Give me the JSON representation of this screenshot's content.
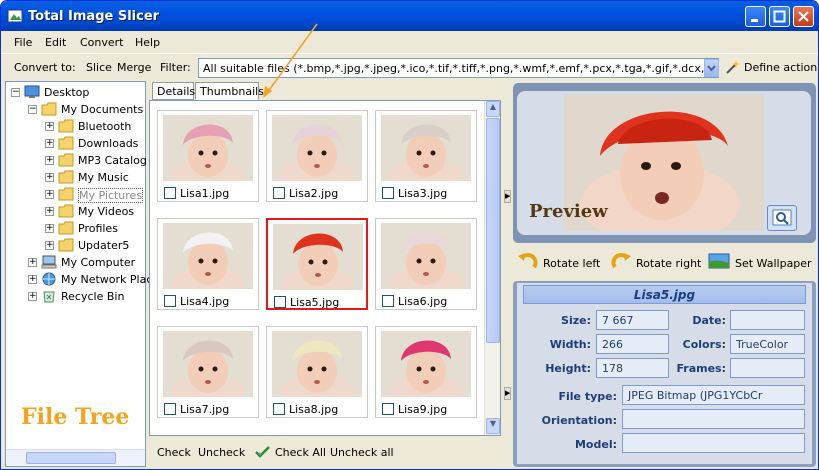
{
  "window": {
    "title": "Total Image Slicer"
  },
  "menu": {
    "file": "File",
    "edit": "Edit",
    "convert": "Convert",
    "help": "Help"
  },
  "toolbar": {
    "convert_to": "Convert to:",
    "slice": "Slice",
    "merge": "Merge",
    "filter_label": "Filter:",
    "filter_value": "All suitable files (*.bmp,*.jpg,*.jpeg,*.ico,*.tif,*.tiff,*.png,*.wmf,*.emf,*.pcx,*.tga,*.gif,*.dcx,*.pxr",
    "define_action": "Define action"
  },
  "tree": {
    "items": [
      {
        "label": "Desktop",
        "expander": "−",
        "icon": "desktop-icon"
      },
      {
        "label": "My Documents",
        "expander": "−",
        "icon": "folder-icon"
      },
      {
        "label": "Bluetooth",
        "expander": "+",
        "icon": "folder-icon"
      },
      {
        "label": "Downloads",
        "expander": "+",
        "icon": "folder-icon"
      },
      {
        "label": "MP3 Catalog",
        "expander": "+",
        "icon": "folder-icon"
      },
      {
        "label": "My Music",
        "expander": "+",
        "icon": "music-folder-icon"
      },
      {
        "label": "My Pictures",
        "expander": "+",
        "icon": "pictures-folder-icon",
        "selected": true
      },
      {
        "label": "My Videos",
        "expander": "+",
        "icon": "videos-folder-icon"
      },
      {
        "label": "Profiles",
        "expander": "+",
        "icon": "folder-icon"
      },
      {
        "label": "Updater5",
        "expander": "+",
        "icon": "folder-icon"
      },
      {
        "label": "My Computer",
        "expander": "+",
        "icon": "computer-icon"
      },
      {
        "label": "My Network Places",
        "expander": "+",
        "icon": "network-icon"
      },
      {
        "label": "Recycle Bin",
        "expander": "+",
        "icon": "recycle-bin-icon"
      }
    ],
    "caption": "File Tree"
  },
  "tabs": {
    "details": "Details",
    "thumbnails": "Thumbnails",
    "active": "Thumbnails"
  },
  "thumbnails": [
    {
      "name": "Lisa1.jpg",
      "hat": "#e7a1b4"
    },
    {
      "name": "Lisa2.jpg",
      "hat": "#e6d2d8"
    },
    {
      "name": "Lisa3.jpg",
      "hat": "#d9cfc8"
    },
    {
      "name": "Lisa4.jpg",
      "hat": "#f2f2f4"
    },
    {
      "name": "Lisa5.jpg",
      "hat": "#e0331e",
      "selected": true
    },
    {
      "name": "Lisa6.jpg",
      "hat": "#ead7dc"
    },
    {
      "name": "Lisa7.jpg",
      "hat": "#d8c8c0"
    },
    {
      "name": "Lisa8.jpg",
      "hat": "#efe7c0"
    },
    {
      "name": "Lisa9.jpg",
      "hat": "#e03770"
    }
  ],
  "bottom": {
    "check": "Check",
    "uncheck": "Uncheck",
    "check_all": "Check All",
    "uncheck_all": "Uncheck all"
  },
  "preview": {
    "label": "Preview"
  },
  "actions": {
    "rotate_left": "Rotate left",
    "rotate_right": "Rotate right",
    "set_wallpaper": "Set Wallpaper"
  },
  "info": {
    "file_name": "Lisa5.jpg",
    "size_label": "Size:",
    "size": "7 667",
    "date_label": "Date:",
    "date": "",
    "width_label": "Width:",
    "width": "266",
    "colors_label": "Colors:",
    "colors": "TrueColor",
    "height_label": "Height:",
    "height": "178",
    "frames_label": "Frames:",
    "frames": "",
    "file_type_label": "File type:",
    "file_type": "JPEG Bitmap (JPG1YCbCr",
    "orientation_label": "Orientation:",
    "orientation": "",
    "model_label": "Model:",
    "model": ""
  },
  "colors": {
    "titlebar": "#0052e0",
    "selection": "#e51919",
    "annotation": "#f7a21b"
  }
}
